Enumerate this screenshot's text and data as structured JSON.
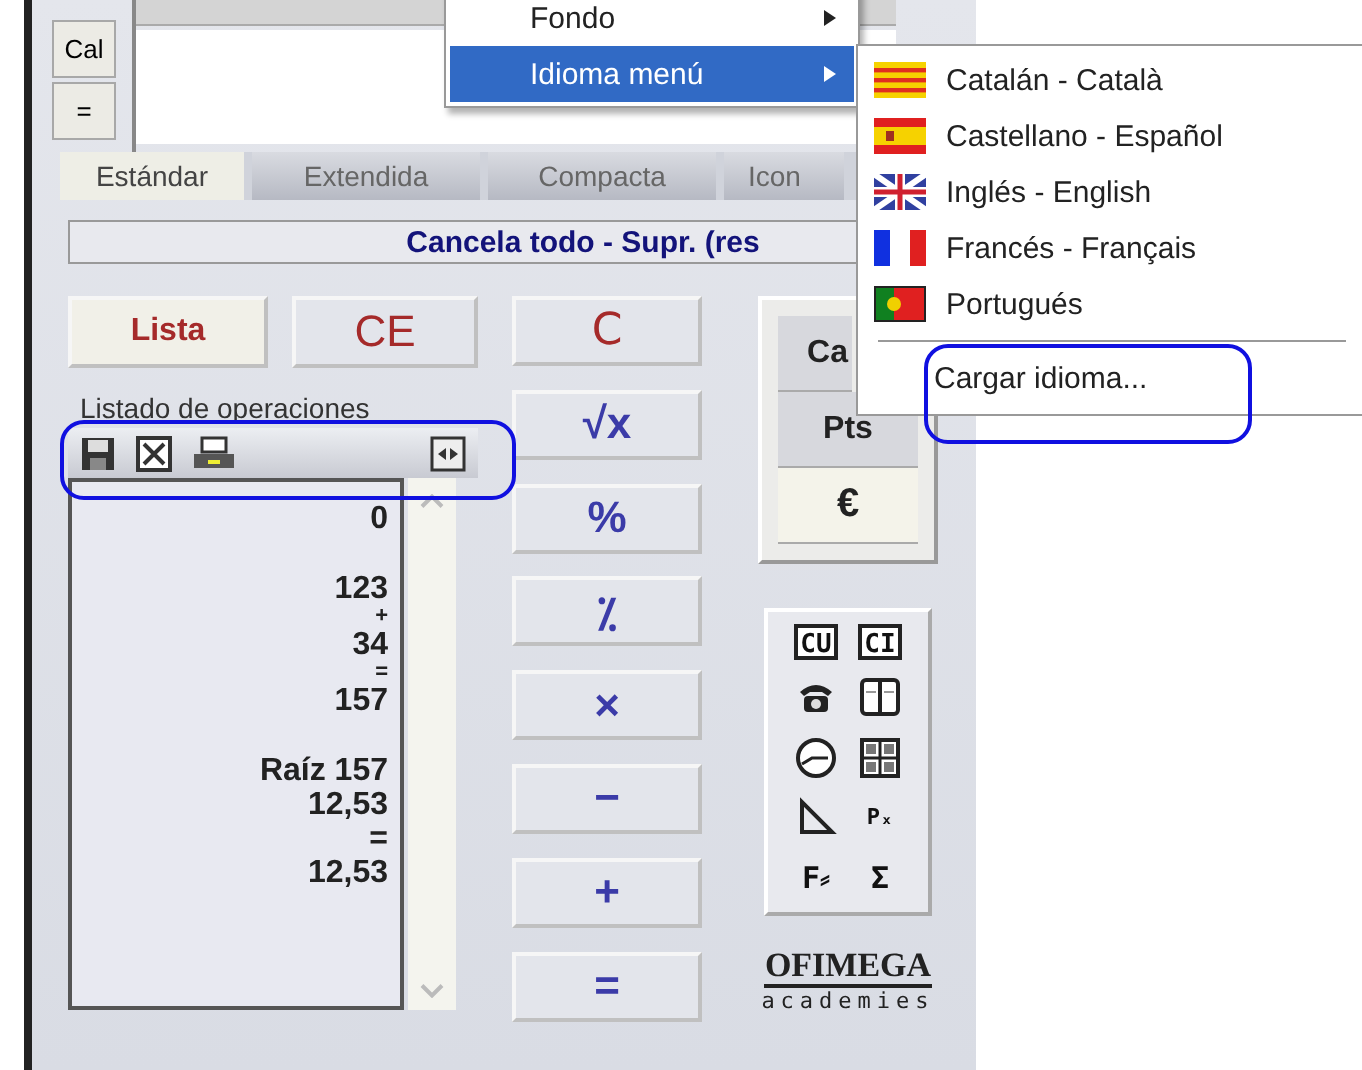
{
  "side_buttons": [
    "Cal",
    "="
  ],
  "tabs": [
    {
      "label": "Estándar",
      "selected": true
    },
    {
      "label": "Extendida",
      "selected": false
    },
    {
      "label": "Compacta",
      "selected": false
    },
    {
      "label": "Icon",
      "selected": false
    }
  ],
  "status_text": "Cancela todo - Supr. (res",
  "top_buttons": [
    {
      "label": "Lista",
      "selected": true
    },
    {
      "label": "CE",
      "selected": false
    }
  ],
  "operator_buttons": [
    "C",
    "√x",
    "%",
    "⁒",
    "×",
    "−",
    "+",
    "="
  ],
  "operations_list": {
    "title": "Listado de operaciones",
    "groups": [
      [
        "0"
      ],
      [
        "123",
        "+",
        "34",
        "=",
        "157"
      ],
      [
        "Raíz 157",
        "12,53",
        "=",
        "12,53"
      ]
    ]
  },
  "currency_buttons": [
    {
      "label": "Ca",
      "selected": false
    },
    {
      "label": "Pts",
      "selected": false
    },
    {
      "label": "€",
      "selected": true
    }
  ],
  "tools": [
    {
      "kind": "label",
      "label": "CU"
    },
    {
      "kind": "label",
      "label": "CI"
    },
    {
      "kind": "icon"
    },
    {
      "kind": "icon"
    },
    {
      "kind": "icon"
    },
    {
      "kind": "icon"
    },
    {
      "kind": "icon"
    },
    {
      "kind": "label",
      "label": "Pₓ"
    },
    {
      "kind": "label",
      "label": "F⸗"
    },
    {
      "kind": "label",
      "label": "Σ"
    }
  ],
  "logo": {
    "name": "OFIMEGA",
    "tagline": "academies"
  },
  "menu": {
    "items": [
      {
        "label": "Fondo",
        "selected": false
      },
      {
        "label": "Idioma menú",
        "selected": true
      }
    ]
  },
  "submenu": {
    "items": [
      {
        "kind": "language",
        "label": "Catalán - Català"
      },
      {
        "kind": "language",
        "label": "Castellano - Español"
      },
      {
        "kind": "language",
        "label": "Inglés - English"
      },
      {
        "kind": "language",
        "label": "Francés - Français"
      },
      {
        "kind": "language",
        "label": "Portugués"
      },
      {
        "kind": "action",
        "label": "Cargar idioma..."
      }
    ]
  }
}
